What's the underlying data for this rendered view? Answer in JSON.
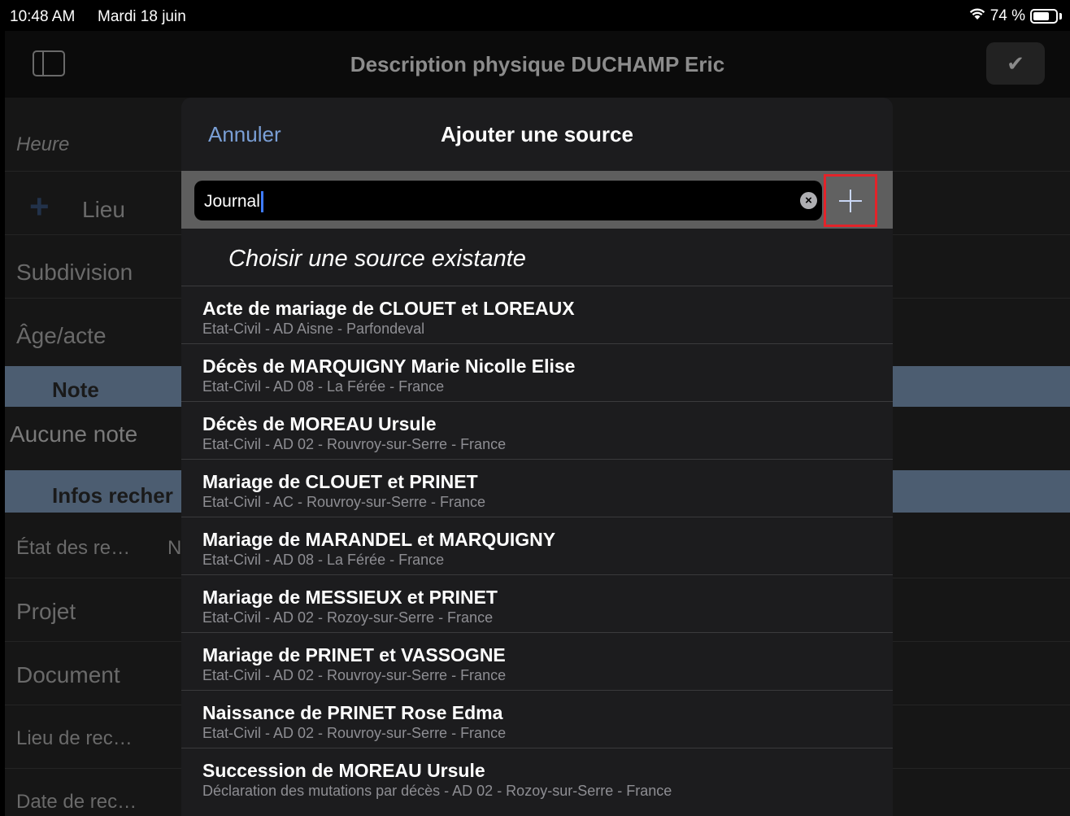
{
  "status": {
    "time": "10:48 AM",
    "date": "Mardi 18 juin",
    "battery": "74 %",
    "battery_level": 0.74
  },
  "nav": {
    "title": "Description physique DUCHAMP Eric",
    "sidebar_icon": "sidebar-icon",
    "done_icon": "checkmark-icon"
  },
  "background_form": {
    "heure": "Heure",
    "lieu": "Lieu",
    "subdivision": "Subdivision",
    "age_acte": "Âge/acte",
    "note_section": "Note",
    "aucune_note": "Aucune note",
    "infos_section": "Infos recher",
    "etat": "État des re…",
    "etat_value": "N",
    "projet": "Projet",
    "document": "Document",
    "lieu_rec": "Lieu de rec…",
    "date_rec": "Date de rec…"
  },
  "modal": {
    "cancel": "Annuler",
    "title": "Ajouter une source",
    "search_value": "Journal",
    "choose_label": "Choisir une source existante",
    "sources": [
      {
        "title": "Acte de mariage de CLOUET et LOREAUX",
        "subtitle": "Etat-Civil - AD Aisne - Parfondeval"
      },
      {
        "title": "Décès de MARQUIGNY Marie Nicolle Elise",
        "subtitle": "Etat-Civil - AD 08 - La Férée - France"
      },
      {
        "title": "Décès de MOREAU Ursule",
        "subtitle": "Etat-Civil - AD 02 - Rouvroy-sur-Serre - France"
      },
      {
        "title": "Mariage de CLOUET et PRINET",
        "subtitle": "Etat-Civil - AC - Rouvroy-sur-Serre - France"
      },
      {
        "title": "Mariage de MARANDEL et MARQUIGNY",
        "subtitle": "Etat-Civil - AD 08 - La Férée - France"
      },
      {
        "title": "Mariage de MESSIEUX et PRINET",
        "subtitle": "Etat-Civil - AD 02 - Rozoy-sur-Serre - France"
      },
      {
        "title": "Mariage de PRINET et VASSOGNE",
        "subtitle": "Etat-Civil - AD 02 - Rouvroy-sur-Serre - France"
      },
      {
        "title": "Naissance de PRINET Rose Edma",
        "subtitle": "Etat-Civil - AD 02 - Rouvroy-sur-Serre - France"
      },
      {
        "title": "Succession de MOREAU Ursule",
        "subtitle": "Déclaration des mutations par décès - AD 02 - Rozoy-sur-Serre - France"
      }
    ]
  },
  "colors": {
    "accent": "#7a9fd6",
    "highlight_border": "#e3232a",
    "section_header": "#4c5d71"
  }
}
